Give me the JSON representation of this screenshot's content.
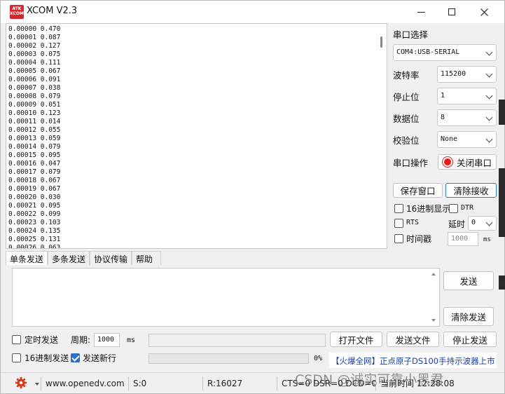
{
  "window": {
    "title": "XCOM V2.3",
    "logo_text": "ATK\nXCOM"
  },
  "receive_lines": [
    "0.00000 0.470",
    "0.00001 0.087",
    "0.00002 0.127",
    "0.00003 0.075",
    "0.00004 0.111",
    "0.00005 0.067",
    "0.00006 0.091",
    "0.00007 0.038",
    "0.00008 0.079",
    "0.00009 0.051",
    "0.00010 0.123",
    "0.00011 0.014",
    "0.00012 0.055",
    "0.00013 0.059",
    "0.00014 0.079",
    "0.00015 0.095",
    "0.00016 0.047",
    "0.00017 0.079",
    "0.00018 0.067",
    "0.00019 0.067",
    "0.00020 0.030",
    "0.00021 0.095",
    "0.00022 0.099",
    "0.00023 0.103",
    "0.00024 0.135",
    "0.00025 0.131",
    "0.00026 0.063"
  ],
  "serial": {
    "port_label": "串口选择",
    "port_value": "COM4:USB-SERIAL",
    "baud_label": "波特率",
    "baud_value": "115200",
    "stop_label": "停止位",
    "stop_value": "1",
    "data_label": "数据位",
    "data_value": "8",
    "parity_label": "校验位",
    "parity_value": "None",
    "op_label": "串口操作",
    "close_port": "关闭串口",
    "save_window": "保存窗口",
    "clear_receive": "清除接收",
    "hex_display": "16进制显示",
    "dtr": "DTR",
    "rts": "RTS",
    "delay_label": "延时",
    "delay_value": "0",
    "timestamp": "时间戳",
    "timestamp_value": "1000",
    "timestamp_unit": "ms"
  },
  "tabs": [
    "单条发送",
    "多条发送",
    "协议传输",
    "帮助"
  ],
  "send": {
    "send_button": "发送",
    "clear_send": "清除发送",
    "timed_send": "定时发送",
    "period_label": "周期:",
    "period_value": "1000",
    "period_unit": "ms",
    "open_file": "打开文件",
    "send_file": "发送文件",
    "stop_send": "停止发送",
    "hex_send": "16进制发送",
    "send_newline": "发送新行",
    "progress_text": "0%",
    "progress_value": 0,
    "ad_text": "【火爆全网】正点原子DS100手持示波器上市"
  },
  "status": {
    "url": "www.openedv.com",
    "sent": "S:0",
    "received": "R:16027",
    "lines": "CTS=0 DSR=0 DCD=0",
    "time_label": "当前时间 12:28:08"
  },
  "watermark": "CSDN @诚实可靠小黑君",
  "colors": {
    "accent": "#2c6fc4",
    "led": "#e81b1b",
    "logo": "#d4262e",
    "ad_text": "#1a3faa"
  }
}
